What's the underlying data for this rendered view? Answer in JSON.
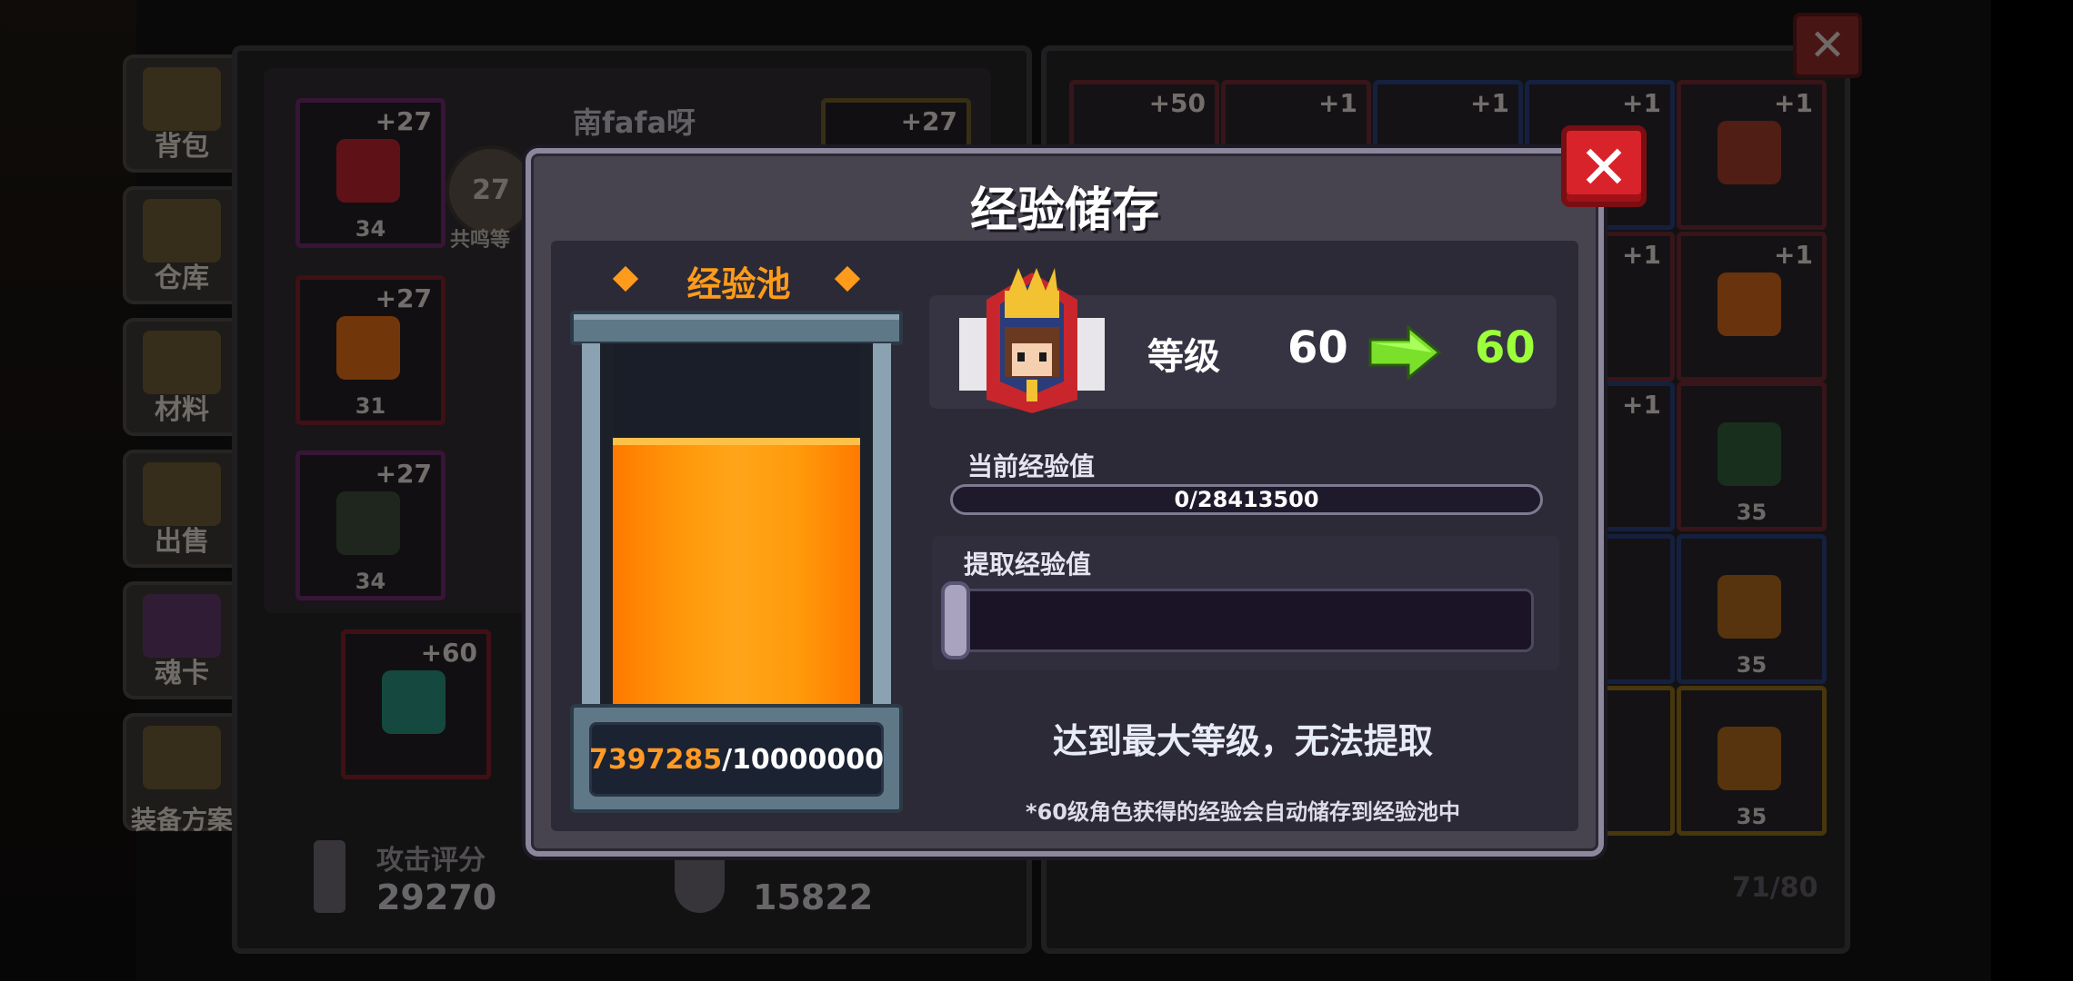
{
  "background": {
    "sidebar": [
      "背包",
      "仓库",
      "材料",
      "出售",
      "魂卡",
      "装备方案"
    ],
    "player_name": "南fafa呀",
    "resonance_label": "共鸣等",
    "resonance_level": "27",
    "equip_slots": [
      {
        "plus": "+27",
        "level": "34"
      },
      {
        "plus": "+27",
        "level": "31"
      },
      {
        "plus": "+27",
        "level": "34"
      },
      {
        "plus": "+60",
        "level": ""
      },
      {
        "plus": "+27",
        "level": ""
      }
    ],
    "attack_label": "攻击评分",
    "attack_value": "29270",
    "defense_value": "15822",
    "inventory_plus": [
      "+50",
      "+1",
      "+1",
      "+1",
      "+1",
      "+1",
      "+1",
      "+1"
    ],
    "inventory_levels": [
      "35",
      "35",
      "35"
    ],
    "inventory_count": "71/80",
    "close_icon": "close-icon"
  },
  "modal": {
    "title": "经验储存",
    "pool_title": "经验池",
    "pool_current": "7397285",
    "pool_max": "/10000000",
    "pool_fill_fraction": 0.7397,
    "level_label": "等级",
    "level_from": "60",
    "level_to": "60",
    "current_exp_label": "当前经验值",
    "current_exp_value": "0/28413500",
    "extract_label": "提取经验值",
    "max_level_message": "达到最大等级，无法提取",
    "footnote": "*60级角色获得的经验会自动储存到经验池中"
  },
  "colors": {
    "accent_orange": "#ff9b1a",
    "level_green": "#9cff3a",
    "close_red": "#d9232b"
  }
}
